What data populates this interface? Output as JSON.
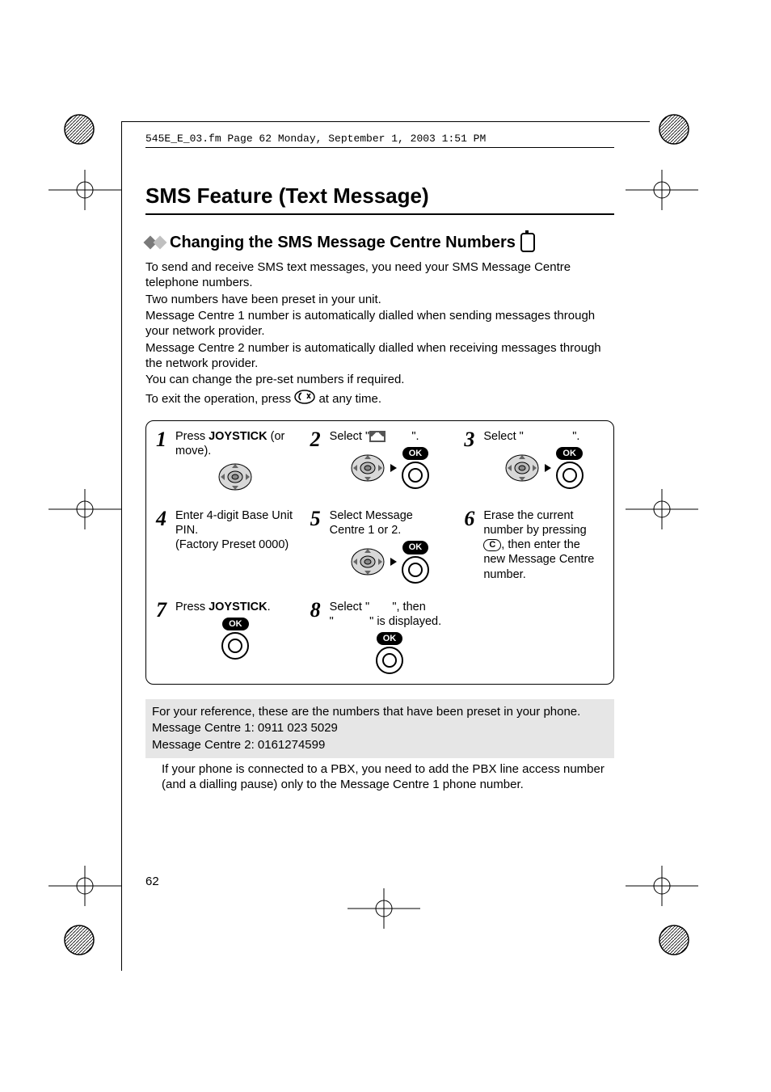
{
  "runhead": "545E_E_03.fm  Page 62  Monday, September 1, 2003  1:51 PM",
  "title": "SMS Feature (Text Message)",
  "subtitle": "Changing the SMS Message Centre Numbers",
  "intro": [
    "To send and receive SMS text messages, you need your SMS Message Centre telephone numbers.",
    "Two numbers have been preset in your unit.",
    "Message Centre 1 number is automatically dialled when sending messages through your network provider.",
    "Message Centre 2 number is automatically dialled when receiving messages through the network provider.",
    "You can change the pre-set numbers if required."
  ],
  "exit_prefix": "To exit the operation, press ",
  "exit_suffix": " at any time.",
  "steps": {
    "s1a": "Press ",
    "s1b": "JOYSTICK",
    "s1c": " (or move).",
    "s2a": "Select \"",
    "s2b": "\".",
    "s3a": "Select \"",
    "s3b": "\".",
    "s4": "Enter 4-digit Base Unit PIN.\n(Factory Preset 0000)",
    "s5": "Select Message Centre 1 or 2.",
    "s6a": "Erase the current number by pressing ",
    "s6b": ", then enter the new Message Centre number.",
    "s7a": "Press ",
    "s7b": "JOYSTICK",
    "s7c": ".",
    "s8a": "Select \"",
    "s8b": "\", then \"",
    "s8c": "\" is displayed.",
    "ok": "OK",
    "c": "C"
  },
  "reference": {
    "line1": "For your reference, these are the numbers that have been preset in your phone.",
    "line2": "Message Centre 1: 0911 023 5029",
    "line3": "Message Centre 2: 0161274599"
  },
  "pbx_note": "If your phone is connected to a PBX, you need to add the PBX line access number (and a dialling pause) only to the Message Centre 1 phone number.",
  "page_number": "62"
}
